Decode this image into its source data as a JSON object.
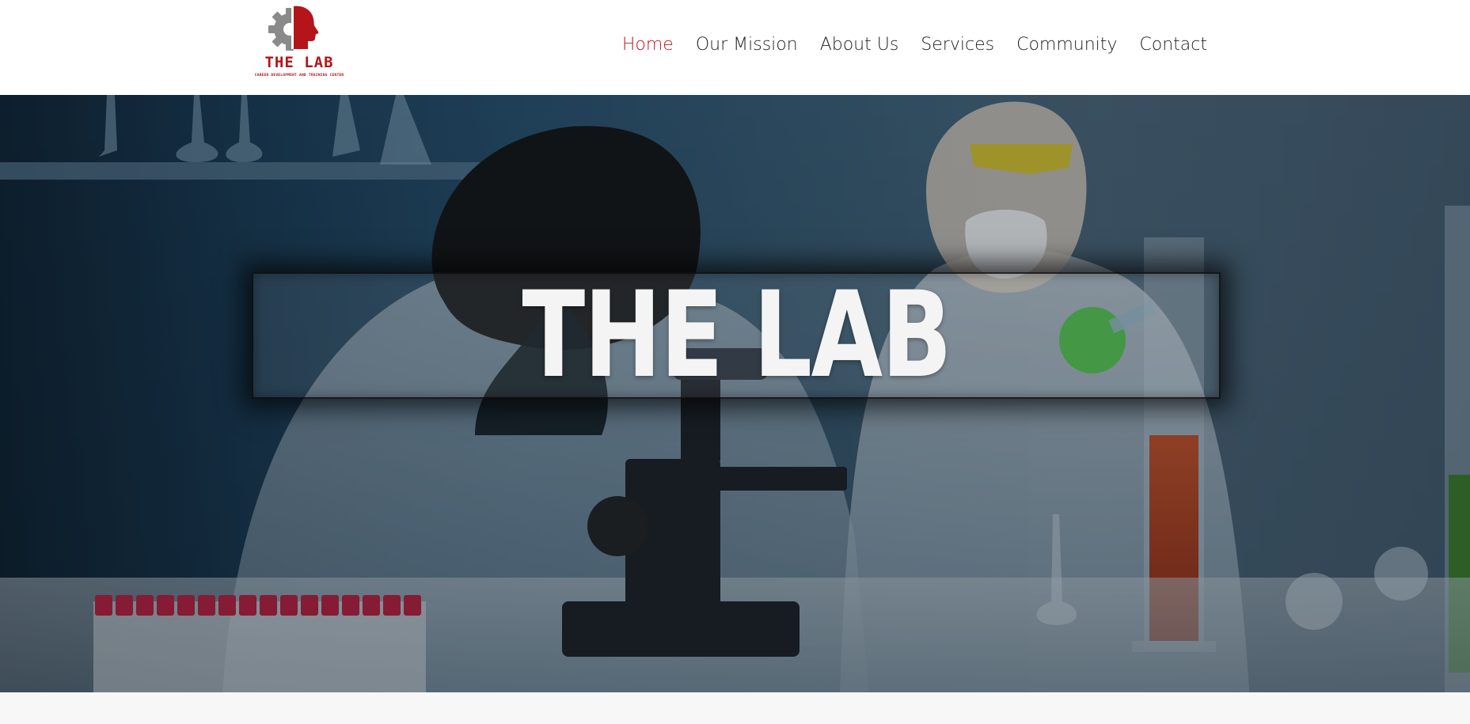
{
  "logo": {
    "title": "THE LAB",
    "subtitle": "CAREER DEVELOPMENT AND TRAINING CENTER",
    "icon": "gear-head-icon",
    "brand_color": "#b3151a"
  },
  "nav": {
    "items": [
      {
        "label": "Home",
        "active": true
      },
      {
        "label": "Our Mission",
        "active": false
      },
      {
        "label": "About Us",
        "active": false
      },
      {
        "label": "Services",
        "active": false
      },
      {
        "label": "Community",
        "active": false
      },
      {
        "label": "Contact",
        "active": false
      }
    ],
    "active_color": "#c0151c"
  },
  "hero": {
    "title": "THE LAB",
    "image": "laboratory-scientists-photo"
  }
}
